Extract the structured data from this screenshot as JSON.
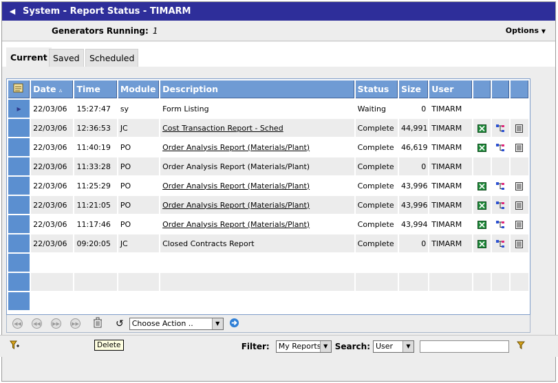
{
  "title": "System - Report Status - TIMARM",
  "generators": {
    "label": "Generators Running:",
    "value": "1"
  },
  "options_label": "Options",
  "tabs": [
    "Current",
    "Saved",
    "Scheduled"
  ],
  "columns": {
    "date": "Date",
    "time": "Time",
    "module": "Module",
    "description": "Description",
    "status": "Status",
    "size": "Size",
    "user": "User"
  },
  "rows": [
    {
      "date": "22/03/06",
      "time": "15:27:47",
      "module": "sy",
      "description": "Form Listing",
      "link": false,
      "status": "Waiting",
      "size": "0",
      "user": "TIMARM",
      "icons": false,
      "current": true
    },
    {
      "date": "22/03/06",
      "time": "12:36:53",
      "module": "JC",
      "description": "Cost Transaction Report - Sched",
      "link": true,
      "status": "Complete",
      "size": "44,991",
      "user": "TIMARM",
      "icons": true
    },
    {
      "date": "22/03/06",
      "time": "11:40:19",
      "module": "PO",
      "description": "Order Analysis Report (Materials/Plant)",
      "link": true,
      "status": "Complete",
      "size": "46,619",
      "user": "TIMARM",
      "icons": true
    },
    {
      "date": "22/03/06",
      "time": "11:33:28",
      "module": "PO",
      "description": "Order Analysis Report (Materials/Plant)",
      "link": false,
      "status": "Complete",
      "size": "0",
      "user": "TIMARM",
      "icons": false
    },
    {
      "date": "22/03/06",
      "time": "11:25:29",
      "module": "PO",
      "description": "Order Analysis Report (Materials/Plant)",
      "link": true,
      "status": "Complete",
      "size": "43,996",
      "user": "TIMARM",
      "icons": true
    },
    {
      "date": "22/03/06",
      "time": "11:21:05",
      "module": "PO",
      "description": "Order Analysis Report (Materials/Plant)",
      "link": true,
      "status": "Complete",
      "size": "43,996",
      "user": "TIMARM",
      "icons": true
    },
    {
      "date": "22/03/06",
      "time": "11:17:46",
      "module": "PO",
      "description": "Order Analysis Report (Materials/Plant)",
      "link": true,
      "status": "Complete",
      "size": "43,994",
      "user": "TIMARM",
      "icons": true
    },
    {
      "date": "22/03/06",
      "time": "09:20:05",
      "module": "JC",
      "description": "Closed Contracts Report",
      "link": false,
      "status": "Complete",
      "size": "0",
      "user": "TIMARM",
      "icons": true
    }
  ],
  "empty_rows": 3,
  "toolbar": {
    "action_select": "Choose Action ..",
    "tooltip": "Delete"
  },
  "filter": {
    "filter_label": "Filter:",
    "filter_value": "My Reports",
    "search_label": "Search:",
    "search_field": "User",
    "search_value": ""
  },
  "icons": {
    "excel": "excel-icon",
    "hierarchy": "hierarchy-icon",
    "document": "document-icon",
    "delete": "trash-icon",
    "refresh": "undo-icon",
    "go": "go-arrow-icon",
    "filter": "filter-icon",
    "add_filter": "add-filter-icon"
  },
  "colors": {
    "title_bar": "#2e2e9a",
    "header": "#6f9bd4",
    "row_alt": "#ececec"
  }
}
